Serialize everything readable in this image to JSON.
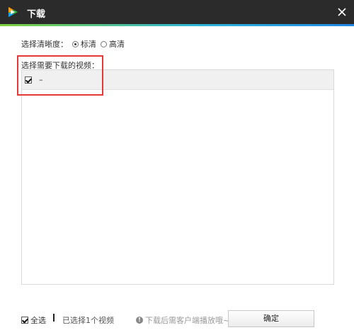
{
  "window": {
    "title": "下载"
  },
  "resolution": {
    "label": "选择清晰度：",
    "options": [
      {
        "label": "标清",
        "checked": true
      },
      {
        "label": "高清",
        "checked": false
      }
    ]
  },
  "video_list": {
    "label": "选择需要下载的视频：",
    "items": [
      {
        "title": "–",
        "checked": true
      }
    ]
  },
  "footer": {
    "select_all_label": "全选",
    "select_all_checked": true,
    "selected_count_text": "已选择1个视频",
    "hint_text": "下载后需客户端播放哦~",
    "confirm_label": "确定"
  },
  "colors": {
    "titlebar": "#2b2b2b",
    "accent_start": "#7fd13b",
    "accent_end": "#1e88e5",
    "highlight_box": "#e53935"
  }
}
